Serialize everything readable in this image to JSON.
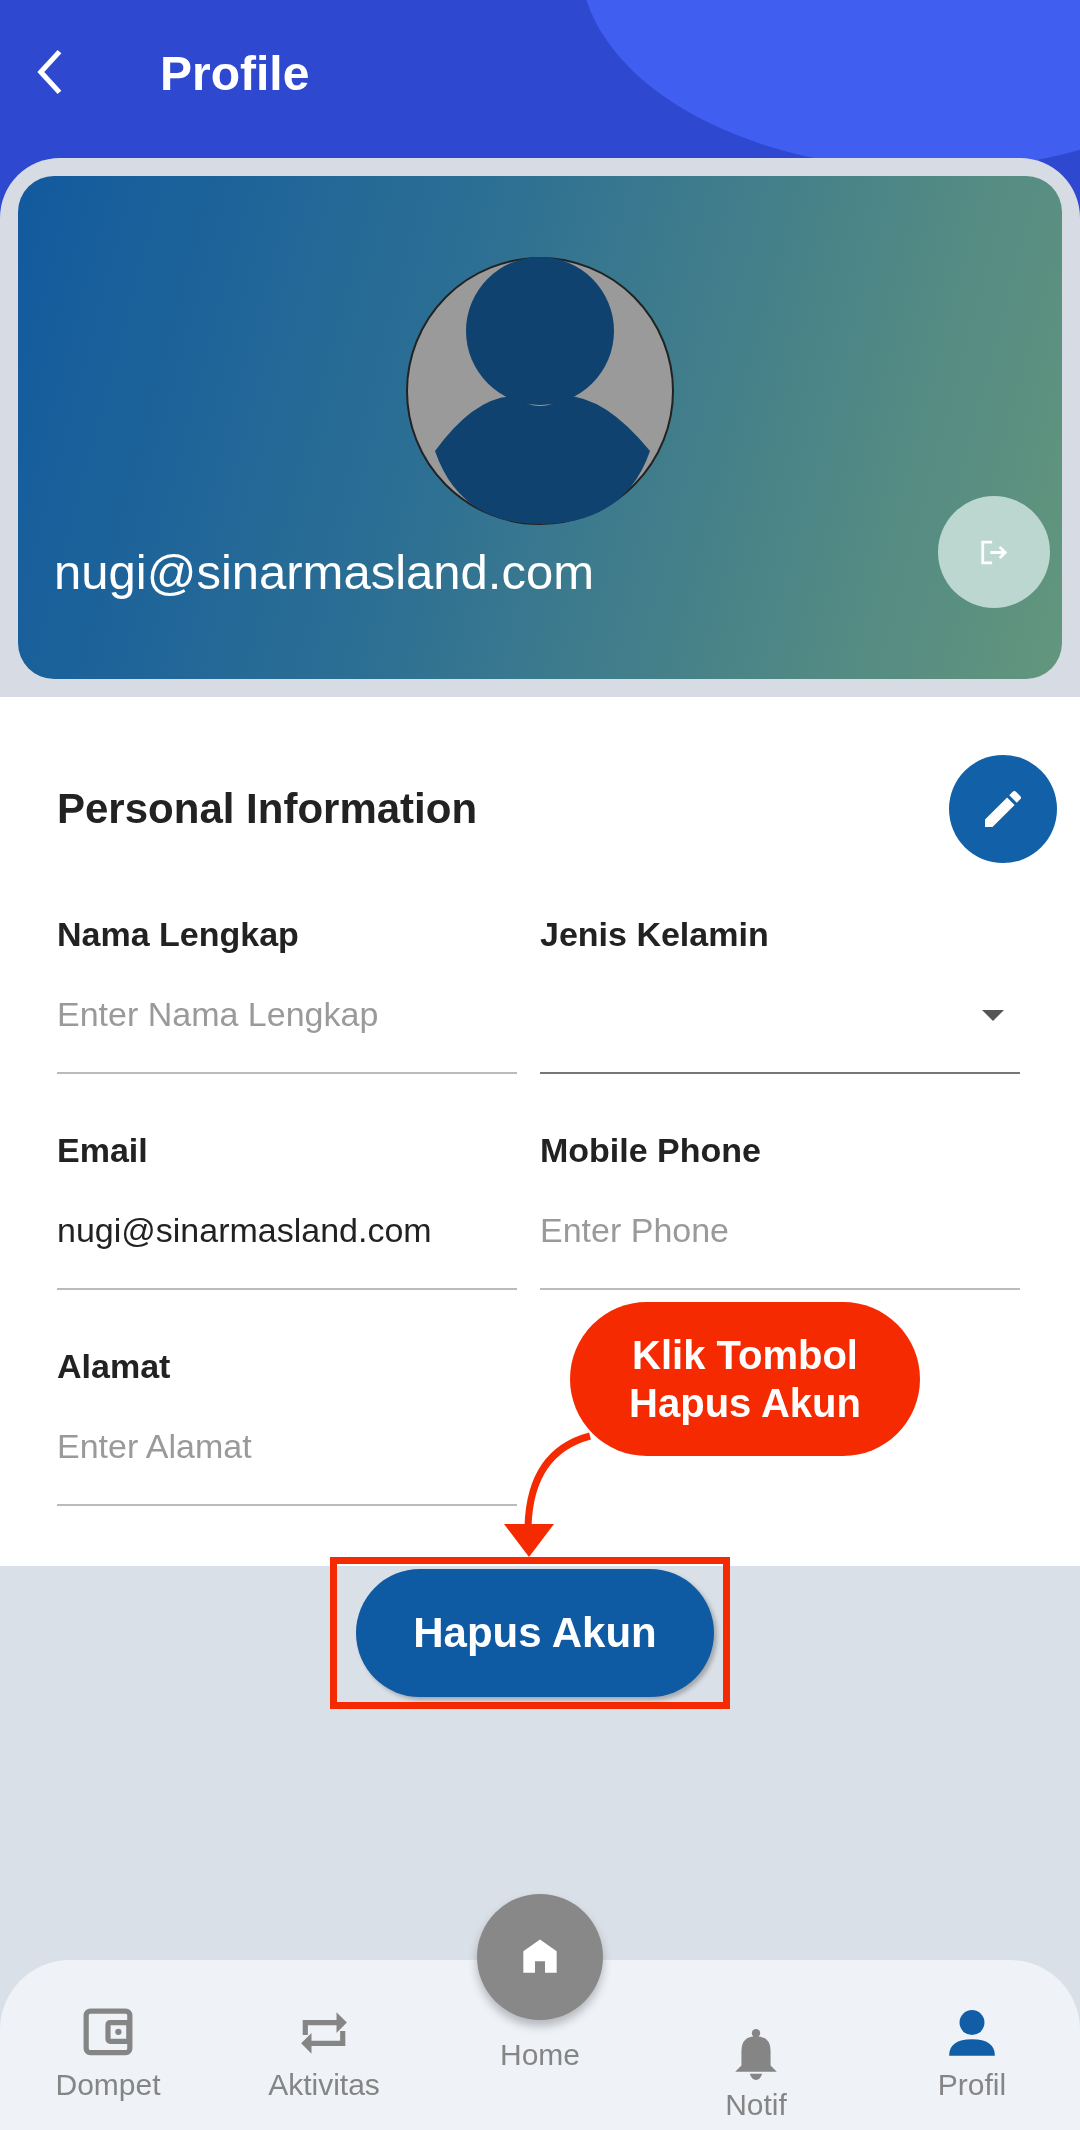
{
  "header": {
    "title": "Profile"
  },
  "profile_card": {
    "email": "nugi@sinarmasland.com"
  },
  "personal_information": {
    "title": "Personal Information",
    "fields": [
      {
        "kind": "text",
        "label": "Nama Lengkap",
        "placeholder": "Enter Nama Lengkap"
      },
      {
        "kind": "dropdown",
        "label": "Jenis Kelamin"
      },
      {
        "kind": "text",
        "label": "Email",
        "value": "nugi@sinarmasland.com"
      },
      {
        "kind": "text",
        "label": "Mobile Phone",
        "placeholder": "Enter Phone"
      },
      {
        "kind": "text",
        "label": "Alamat",
        "placeholder": "Enter Alamat"
      }
    ]
  },
  "delete_button": {
    "label": "Hapus Akun"
  },
  "annotation": {
    "text": "Klik Tombol Hapus Akun"
  },
  "bottom_nav": [
    {
      "kind": "tab",
      "label": "Dompet",
      "selected": false
    },
    {
      "kind": "tab",
      "label": "Aktivitas",
      "selected": false
    },
    {
      "kind": "center",
      "label": "Home",
      "selected": false
    },
    {
      "kind": "tab",
      "label": "Notif",
      "selected": false
    },
    {
      "kind": "tab",
      "label": "Profil",
      "selected": true
    }
  ]
}
